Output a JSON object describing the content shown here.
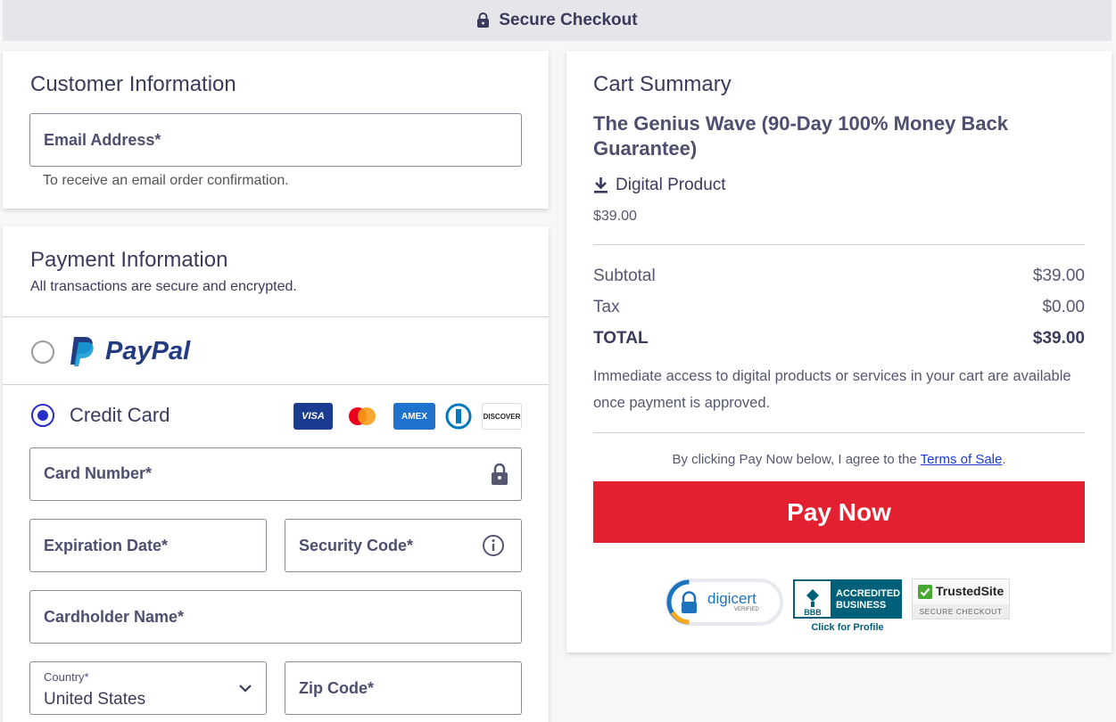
{
  "header": {
    "title": "Secure Checkout"
  },
  "customer": {
    "title": "Customer Information",
    "email_label": "Email Address*",
    "email_hint": "To receive an email order confirmation."
  },
  "payment": {
    "title": "Payment Information",
    "subtitle": "All transactions are secure and encrypted.",
    "paypal_label": "PayPal",
    "credit_card_label": "Credit Card",
    "selected_method": "credit_card",
    "card_brands": [
      "VISA",
      "mastercard",
      "AMEX",
      "diners",
      "DISCOVER"
    ],
    "card_number_label": "Card Number*",
    "expiration_label": "Expiration Date*",
    "security_code_label": "Security Code*",
    "cardholder_label": "Cardholder Name*",
    "country_label": "Country*",
    "country_value": "United States",
    "zip_label": "Zip Code*"
  },
  "cart": {
    "title": "Cart Summary",
    "product_name": "The Genius Wave (90-Day 100% Money Back Guarantee)",
    "product_type": "Digital Product",
    "product_price": "$39.00",
    "subtotal_label": "Subtotal",
    "subtotal_value": "$39.00",
    "tax_label": "Tax",
    "tax_value": "$0.00",
    "total_label": "TOTAL",
    "total_value": "$39.00",
    "access_note": "Immediate access to digital products or services in your cart are available once payment is approved.",
    "agree_text": "By clicking Pay Now below, I agree to the ",
    "terms_link": "Terms of Sale",
    "agree_end": ".",
    "pay_button": "Pay Now"
  },
  "badges": {
    "digicert": "digicert",
    "digicert_sub": "VERIFIED",
    "bbb_line1": "ACCREDITED",
    "bbb_line2": "BUSINESS",
    "bbb_mark": "BBB",
    "bbb_profile": "Click for Profile",
    "trusted_name": "TrustedSite",
    "trusted_sub": "SECURE CHECKOUT"
  },
  "colors": {
    "accent": "#2a2ec9",
    "pay_button": "#e3202f",
    "text": "#46476a"
  }
}
